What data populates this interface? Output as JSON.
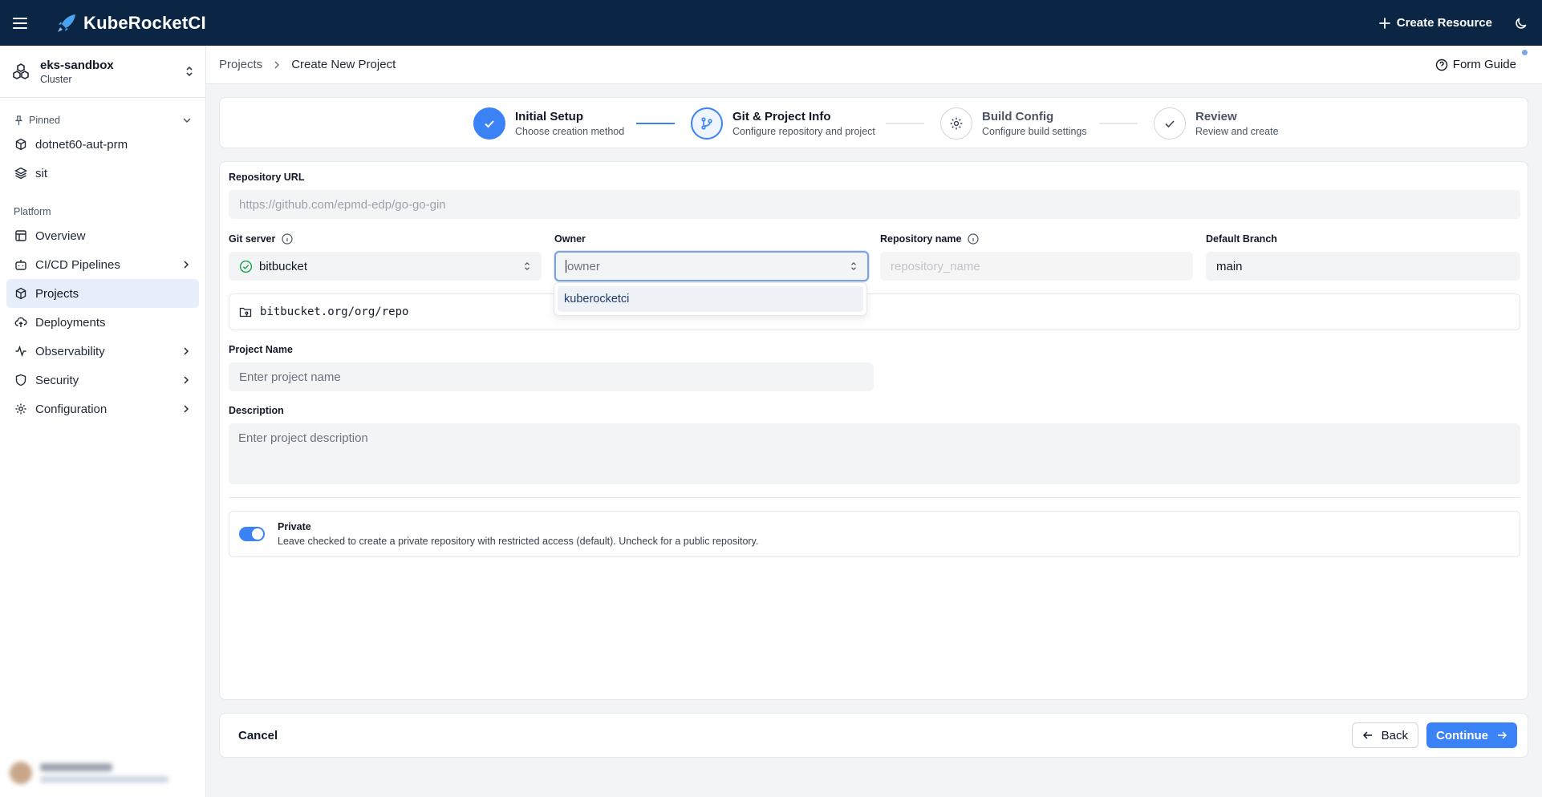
{
  "header": {
    "brand": "KubeRocketCI",
    "create_resource": "Create Resource",
    "brand_color": "#0b2545",
    "accent_color": "#3b82f6"
  },
  "sidebar": {
    "cluster_name": "eks-sandbox",
    "cluster_type": "Cluster",
    "pinned_label": "Pinned",
    "pinned_items": [
      {
        "label": "dotnet60-aut-prm",
        "icon": "box-icon"
      },
      {
        "label": "sit",
        "icon": "layers-icon"
      }
    ],
    "platform_label": "Platform",
    "items": [
      {
        "label": "Overview",
        "icon": "layout-icon"
      },
      {
        "label": "CI/CD Pipelines",
        "icon": "bot-icon",
        "expandable": true
      },
      {
        "label": "Projects",
        "icon": "box-icon",
        "active": true
      },
      {
        "label": "Deployments",
        "icon": "cloud-upload-icon"
      },
      {
        "label": "Observability",
        "icon": "activity-icon",
        "expandable": true
      },
      {
        "label": "Security",
        "icon": "shield-icon",
        "expandable": true
      },
      {
        "label": "Configuration",
        "icon": "gear-icon",
        "expandable": true
      }
    ]
  },
  "breadcrumb": {
    "parent": "Projects",
    "current": "Create New Project",
    "form_guide": "Form Guide"
  },
  "stepper": {
    "steps": [
      {
        "title": "Initial Setup",
        "desc": "Choose creation method",
        "state": "done"
      },
      {
        "title": "Git & Project Info",
        "desc": "Configure repository and project",
        "state": "current"
      },
      {
        "title": "Build Config",
        "desc": "Configure build settings",
        "state": "upcoming"
      },
      {
        "title": "Review",
        "desc": "Review and create",
        "state": "upcoming"
      }
    ]
  },
  "form": {
    "repo_url_label": "Repository URL",
    "repo_url_placeholder": "https://github.com/epmd-edp/go-go-gin",
    "git_server_label": "Git server",
    "git_server_value": "bitbucket",
    "owner_label": "Owner",
    "owner_placeholder": "owner",
    "repo_name_label": "Repository name",
    "repo_name_placeholder": "repository_name",
    "default_branch_label": "Default Branch",
    "default_branch_value": "main",
    "repo_path": "bitbucket.org/org/repo",
    "project_name_label": "Project Name",
    "project_name_placeholder": "Enter project name",
    "description_label": "Description",
    "description_placeholder": "Enter project description",
    "private_title": "Private",
    "private_desc": "Leave checked to create a private repository with restricted access (default). Uncheck for a public repository.",
    "private_enabled": true,
    "owner_options": [
      "kuberocketci"
    ]
  },
  "footer": {
    "cancel": "Cancel",
    "back": "Back",
    "continue": "Continue"
  }
}
